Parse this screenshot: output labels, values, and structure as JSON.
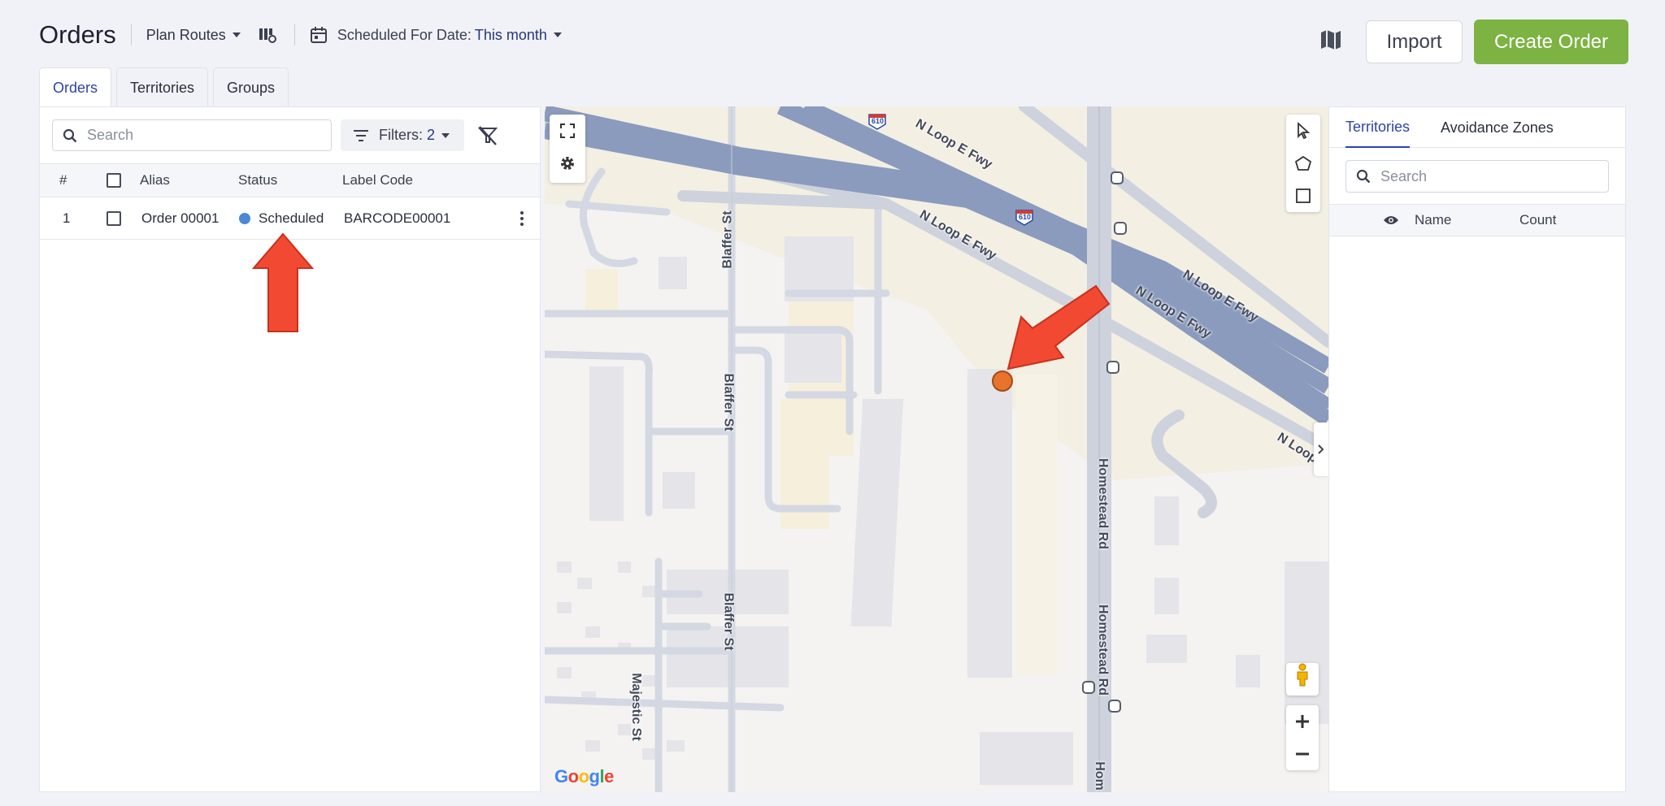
{
  "header": {
    "title": "Orders",
    "plan_routes_label": "Plan Routes",
    "date_filter_label": "Scheduled For Date:",
    "date_filter_value": "This month",
    "import_label": "Import",
    "create_order_label": "Create Order"
  },
  "tabs": [
    {
      "label": "Orders",
      "active": true
    },
    {
      "label": "Territories",
      "active": false
    },
    {
      "label": "Groups",
      "active": false
    }
  ],
  "orders_panel": {
    "search_placeholder": "Search",
    "filters_label": "Filters:",
    "filters_count": "2",
    "columns": [
      "#",
      "Alias",
      "Status",
      "Label Code"
    ],
    "rows": [
      {
        "index": "1",
        "alias": "Order 00001",
        "status": "Scheduled",
        "status_color": "#4a87d6",
        "label_code": "BARCODE00001"
      }
    ]
  },
  "map": {
    "road_labels": {
      "loop1": "N Loop E Fwy",
      "loop2": "N Loop E Fwy",
      "loop3": "N Loop E Fwy",
      "loop4": "N Loop E Fwy",
      "loop5": "N Loop",
      "blaffer1": "Blaffer St",
      "blaffer2": "Blaffer St",
      "blaffer3": "Blaffer St",
      "homestead1": "Homestead Rd",
      "homestead2": "Homestead Rd",
      "homestead3": "Hom",
      "majestic": "Majestic St",
      "shield1": "610",
      "shield2": "610"
    },
    "provider": "Google",
    "marker_color": "#e8732a"
  },
  "territories_panel": {
    "tabs": [
      {
        "label": "Territories",
        "active": true
      },
      {
        "label": "Avoidance Zones",
        "active": false
      }
    ],
    "search_placeholder": "Search",
    "columns": [
      "Name",
      "Count"
    ]
  },
  "colors": {
    "accent": "#2d43a8",
    "create_button": "#7cb342",
    "annotation_arrow": "#f24a32"
  }
}
